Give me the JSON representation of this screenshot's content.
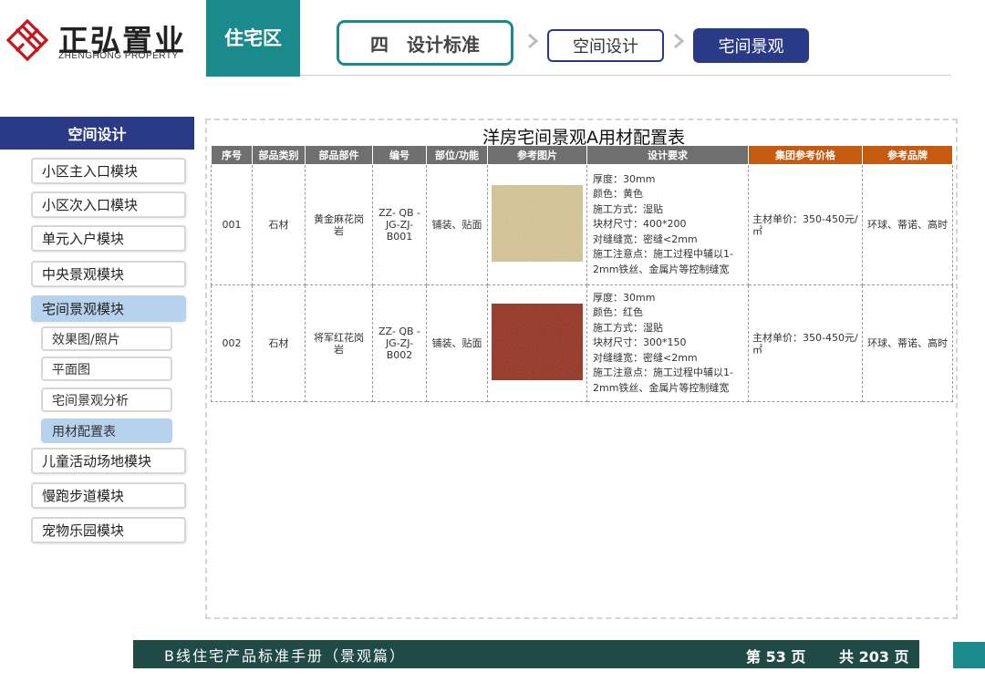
{
  "header": {
    "logo_cn": "正弘置业",
    "logo_en": "ZHENGHONG PROPERTY",
    "section_tab": "住宅区",
    "breadcrumb": [
      "四　设计标准",
      "空间设计",
      "宅间景观"
    ],
    "colors": {
      "teal": "#1a8a8a",
      "navy": "#2b3a86",
      "logo_red": "#c8161d"
    }
  },
  "sidebar": {
    "heading": "空间设计",
    "items": [
      {
        "label": "小区主入口模块",
        "active": false
      },
      {
        "label": "小区次入口模块",
        "active": false
      },
      {
        "label": "单元入户模块",
        "active": false
      },
      {
        "label": "中央景观模块",
        "active": false
      },
      {
        "label": "宅间景观模块",
        "active": true
      },
      {
        "label": "儿童活动场地模块",
        "active": false
      },
      {
        "label": "慢跑步道模块",
        "active": false
      },
      {
        "label": "宠物乐园模块",
        "active": false
      }
    ],
    "subitems": [
      {
        "label": "效果图/照片",
        "active": false
      },
      {
        "label": "平面图",
        "active": false
      },
      {
        "label": "宅间景观分析",
        "active": false
      },
      {
        "label": "用材配置表",
        "active": true
      }
    ]
  },
  "table": {
    "title": "洋房宅间景观A用材配置表",
    "headers": [
      "序号",
      "部品类别",
      "部品部件",
      "编号",
      "部位/功能",
      "参考图片",
      "设计要求",
      "集团参考价格",
      "参考品牌"
    ],
    "header_highlight_color": "#c55a11",
    "rows": [
      {
        "no": "001",
        "category": "石材",
        "component": "黄金麻花岗岩",
        "code": "ZZ- QB -JG-ZJ-B001",
        "position": "铺装、贴面",
        "image_icon": "yellow-granite-swatch",
        "requirements": [
          "厚度：30mm",
          "颜色：黄色",
          "施工方式：湿贴",
          "块材尺寸：400*200",
          "对缝缝宽：密缝<2mm",
          "施工注意点：施工过程中辅以1-2mm铁丝、金属片等控制缝宽"
        ],
        "price": "主材单价：350-450元/㎡",
        "brand": "环球、蒂诺、高时"
      },
      {
        "no": "002",
        "category": "石材",
        "component": "将军红花岗岩",
        "code": "ZZ- QB -JG-ZJ-B002",
        "position": "铺装、贴面",
        "image_icon": "red-granite-swatch",
        "requirements": [
          "厚度：30mm",
          "颜色：红色",
          "施工方式：湿贴",
          "块材尺寸：300*150",
          "对缝缝宽：密缝<2mm",
          "施工注意点：施工过程中辅以1-2mm铁丝、金属片等控制缝宽"
        ],
        "price": "主材单价：350-450元/㎡",
        "brand": "环球、蒂诺、高时"
      }
    ]
  },
  "footer": {
    "title": "B线住宅产品标准手册（景观篇）",
    "page": "第 53 页",
    "total": "共 203 页"
  }
}
